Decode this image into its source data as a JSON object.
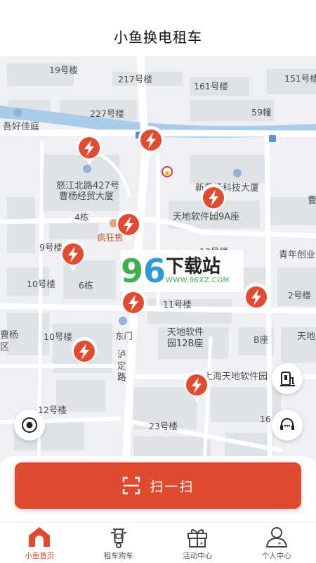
{
  "header": {
    "title": "小鱼换电租车"
  },
  "map": {
    "labels": {
      "l1": "19号楼",
      "l2": "217号楼",
      "l3": "161号楼",
      "l4": "151号楼",
      "l5": "227号楼",
      "l6": "59幢",
      "l7": "吾好佳庭",
      "l8": "怒江北路427号",
      "l9": "曹杨经贸大厦",
      "l10": "新曹杨科技大厦",
      "l11": "4栋",
      "l12": "天地软件园9A座",
      "l13": "疯狂售",
      "l14": "9号楼",
      "l15": "13号楼",
      "l16": "青年创业",
      "l17": "10号楼",
      "l18": "6栋",
      "l19": "2号楼",
      "l20": "11号楼",
      "l21": "曹杨",
      "l22": "区",
      "l23": "10号楼",
      "l24": "东门",
      "l25": "天地软件",
      "l26": "园12B座",
      "l27": "B座",
      "l28": "天地",
      "l29": "泸",
      "l30": "定",
      "l31": "路",
      "l32": "上海天地软件园",
      "l33": "12号楼",
      "l34": "23号楼",
      "l35": "16",
      "l36": "曹"
    },
    "watermark": {
      "num_left": "9",
      "num_right": "6",
      "title": "下载站",
      "url": "WWW.96XZ.COM"
    }
  },
  "actions": {
    "scan_label": "扫一扫"
  },
  "tabs": [
    {
      "label": "小鱼首页"
    },
    {
      "label": "租车购车"
    },
    {
      "label": "活动中心"
    },
    {
      "label": "个人中心"
    }
  ],
  "colors": {
    "accent": "#e04a2e",
    "map_bg": "#eef0f3",
    "block": "#dcdfe4",
    "road": "#ffffff"
  }
}
